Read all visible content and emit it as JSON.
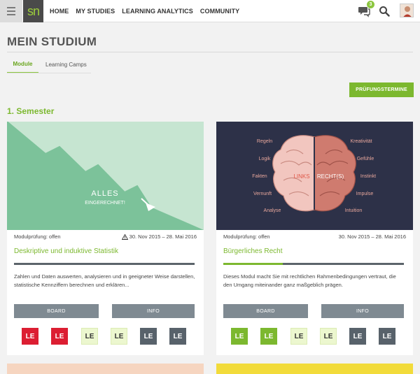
{
  "nav": {
    "logo": "sn",
    "items": [
      "HOME",
      "MY STUDIES",
      "LEARNING ANALYTICS",
      "COMMUNITY"
    ],
    "chat_badge": "3"
  },
  "page": {
    "title": "MEIN STUDIUM",
    "tabs": [
      "Module",
      "Learning Camps"
    ],
    "exam_button": "PRÜFUNGSTERMINE",
    "semester": "1. Semester"
  },
  "cards": [
    {
      "image_text": {
        "big": "ALLES",
        "small": "EINGERECHNET!"
      },
      "exam_status": "Modulprüfung: offen",
      "warning": true,
      "dates": "30. Nov 2015 – 28. Mai 2016",
      "title": "Deskriptive und induktive Statistik",
      "progress": 0,
      "description": "Zahlen und Daten auswerten, analysieren und in geeigneter Weise darstellen, statistische Kennziffern berechnen und erklären...",
      "board_label": "BOARD",
      "info_label": "INFO",
      "le_items": [
        {
          "label": "LE",
          "status": "red"
        },
        {
          "label": "LE",
          "status": "red"
        },
        {
          "label": "LE",
          "status": "light"
        },
        {
          "label": "LE",
          "status": "light"
        },
        {
          "label": "LE",
          "status": "dark"
        },
        {
          "label": "LE",
          "status": "dark"
        }
      ]
    },
    {
      "image_text": {
        "left": [
          "Regeln",
          "Logik",
          "Fakten",
          "Vernunft",
          "Analyse"
        ],
        "right": [
          "Kreativität",
          "Gefühle",
          "Instinkt",
          "Impulse",
          "Intuition"
        ],
        "brain_left": "LINKS",
        "brain_right": "RECHT(S)"
      },
      "exam_status": "Modulprüfung: offen",
      "warning": false,
      "dates": "30. Nov 2015 – 28. Mai 2016",
      "title": "Bürgerliches Recht",
      "progress": 0.33,
      "description": "Dieses Modul macht Sie mit rechtlichen Rahmenbedingungen vertraut, die den Umgang miteinander ganz maßgeblich prägen.",
      "board_label": "BOARD",
      "info_label": "INFO",
      "le_items": [
        {
          "label": "LE",
          "status": "green"
        },
        {
          "label": "LE",
          "status": "green"
        },
        {
          "label": "LE",
          "status": "light"
        },
        {
          "label": "LE",
          "status": "light"
        },
        {
          "label": "LE",
          "status": "dark"
        },
        {
          "label": "LE",
          "status": "dark"
        }
      ]
    }
  ],
  "colors": {
    "accent": "#7cb82f",
    "red": "#dc1e32",
    "dark": "#58626b",
    "light": "#ecf7cf"
  }
}
